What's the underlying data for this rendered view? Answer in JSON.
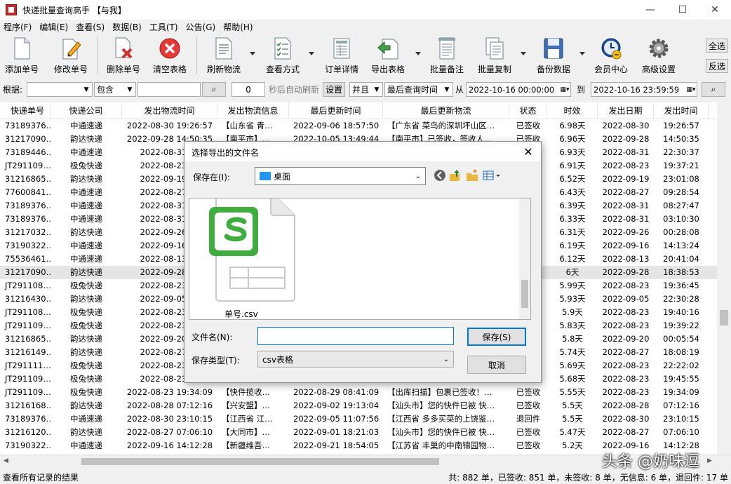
{
  "window": {
    "title": "快递批量查询高手 【与我】",
    "ctrl_minimize": "—",
    "ctrl_maximize": "☐",
    "ctrl_close": "✕"
  },
  "menu": [
    "程序(F)",
    "编辑(E)",
    "查看(S)",
    "数据(B)",
    "工具(T)",
    "公告(G)",
    "帮助(H)"
  ],
  "toolbar": {
    "add": "添加单号",
    "edit": "修改单号",
    "delete": "删除单号",
    "clear": "清空表格",
    "refresh": "刷新物流",
    "view_mode": "查看方式",
    "order_detail": "订单详情",
    "export": "导出表格",
    "batch_note": "批量备注",
    "batch_copy": "批量复制",
    "backup": "备份数据",
    "member": "会员中心",
    "advanced": "高级设置",
    "select_all": "全选",
    "invert": "反选"
  },
  "filter": {
    "label": "根据:",
    "field_value": "",
    "match_value": "包含",
    "keyword": "",
    "search_icon": "⌕",
    "interval_value": "0",
    "auto_refresh_text": "秒后自动刷新",
    "set_button": "设置",
    "logic_value": "并且",
    "time_field_value": "最后查询时间",
    "from_label": "从",
    "from_value": "2022-10-16 00:00:00",
    "to_label": "到",
    "to_value": "2022-10-16 23:59:59"
  },
  "table": {
    "columns": [
      "快递单号",
      "快递公司",
      "发出物流时间",
      "发出物流信息",
      "最后更新时间",
      "最后更新物流",
      "状态",
      "时效",
      "发出日期",
      "发出时间"
    ],
    "selected_row": 11,
    "rows": [
      [
        "73189376…",
        "中通速递",
        "2022-08-30 19:26:57",
        "【山东省 青…",
        "2022-09-06 18:57:50",
        "【广东省 菜鸟的深圳坪山区…",
        "已签收",
        "6.98天",
        "2022-08-30",
        "19:26:57"
      ],
      [
        "31217090…",
        "韵达快递",
        "2022-09-28 14:50:35",
        "【南平市】…",
        "2022-10-05 13:49:44",
        "【南平市】已签收，签收人…",
        "已签收",
        "6.96天",
        "2022-09-28",
        "14:50:35"
      ],
      [
        "73189446…",
        "中通速递",
        "2022-08-31 22",
        "",
        "",
        "",
        "已签收",
        "6.93天",
        "2022-08-31",
        "22:30:37"
      ],
      [
        "JT291109…",
        "极兔快递",
        "2022-08-23 19",
        "",
        "",
        "",
        "已签收",
        "6.91天",
        "2022-08-23",
        "19:37:21"
      ],
      [
        "31216865…",
        "韵达快递",
        "2022-09-19 23",
        "",
        "",
        "",
        "已签收",
        "6.52天",
        "2022-09-19",
        "23:01:08"
      ],
      [
        "77600841…",
        "中通速递",
        "2022-08-27 09",
        "",
        "",
        "",
        "已签收",
        "6.43天",
        "2022-08-27",
        "09:28:54"
      ],
      [
        "73189376…",
        "中通速递",
        "2022-08-31 08",
        "",
        "",
        "",
        "已签收",
        "6.39天",
        "2022-08-31",
        "08:27:47"
      ],
      [
        "73189376…",
        "中通速递",
        "2022-08-31 03",
        "",
        "",
        "",
        "已签收",
        "6.33天",
        "2022-08-31",
        "03:10:30"
      ],
      [
        "31217032…",
        "韵达快递",
        "2022-09-26 00",
        "",
        "",
        "",
        "已签收",
        "6.31天",
        "2022-09-26",
        "00:28:08"
      ],
      [
        "73190322…",
        "中通速递",
        "2022-09-16 14",
        "",
        "",
        "",
        "已签收",
        "6.19天",
        "2022-09-16",
        "14:13:24"
      ],
      [
        "75536461…",
        "中通速递",
        "2022-08-13 20",
        "",
        "",
        "",
        "已签收",
        "6.12天",
        "2022-08-13",
        "20:41:04"
      ],
      [
        "31217090…",
        "韵达快递",
        "2022-09-28 18",
        "",
        "",
        "",
        "已签收",
        "6天",
        "2022-09-28",
        "18:38:53"
      ],
      [
        "JT291108…",
        "极兔快递",
        "2022-08-23 19",
        "",
        "",
        "",
        "已签收",
        "5.99天",
        "2022-08-23",
        "19:36:45"
      ],
      [
        "31216430…",
        "韵达快递",
        "2022-09-05 22",
        "",
        "",
        "",
        "已签收",
        "5.93天",
        "2022-09-05",
        "22:30:28"
      ],
      [
        "JT291108…",
        "极兔快递",
        "2022-08-23 19",
        "",
        "",
        "",
        "已签收",
        "5.9天",
        "2022-08-23",
        "19:40:16"
      ],
      [
        "JT291109…",
        "极兔快递",
        "2022-08-23 19",
        "",
        "",
        "",
        "已签收",
        "5.83天",
        "2022-08-23",
        "19:39:22"
      ],
      [
        "31216865…",
        "韵达快递",
        "2022-09-20 00",
        "",
        "",
        "",
        "已签收",
        "5.8天",
        "2022-09-20",
        "00:05:54"
      ],
      [
        "31216149…",
        "韵达快递",
        "2022-08-27 18",
        "",
        "",
        "",
        "已签收",
        "5.74天",
        "2022-08-27",
        "18:08:19"
      ],
      [
        "JT291111…",
        "极兔快递",
        "2022-08-23 22",
        "",
        "",
        "",
        "已签收",
        "5.69天",
        "2022-08-23",
        "22:22:02"
      ],
      [
        "JT291109…",
        "极兔快递",
        "2022-08-23 19",
        "",
        "",
        "",
        "已签收",
        "5.68天",
        "2022-08-23",
        "19:45:55"
      ],
      [
        "JT291109…",
        "极兔快递",
        "2022-08-23 19:34:09",
        "【快件揽收…",
        "2022-08-29 08:41:09",
        "【出库扫描】包裹已签收！…",
        "已签收",
        "5.55天",
        "2022-08-23",
        "19:34:09"
      ],
      [
        "31216168…",
        "韵达快递",
        "2022-08-28 07:12:16",
        "【兴安盟】…",
        "2022-09-02 19:13:04",
        "【汕头市】您的快件已被 快…",
        "已签收",
        "5.5天",
        "2022-08-28",
        "07:12:16"
      ],
      [
        "73189376…",
        "中通速递",
        "2022-08-30 23:10:15",
        "【江西省 江…",
        "2022-09-05 11:07:56",
        "【江西省 多多买菜的上饶鉴…",
        "退回件",
        "5.5天",
        "2022-08-30",
        "23:10:15"
      ],
      [
        "31216120…",
        "韵达快递",
        "2022-08-27 07:06:10",
        "【大同市】…",
        "2022-09-01 18:21:03",
        "【汕头市】您的快件已被 快…",
        "已签收",
        "5.47天",
        "2022-08-27",
        "07:06:10"
      ],
      [
        "73190322…",
        "中通速递",
        "2022-09-16 14:12:28",
        "【新疆维吾…",
        "2022-09-21 18:54:05",
        "【江苏省 丰巢的中南锦园物…",
        "已签收",
        "5.2天",
        "2022-09-16",
        "14:12:28"
      ]
    ]
  },
  "status": {
    "left": "查看所有记录的结果",
    "right": "共: 882 单，已签收: 851 单，未签收: 8 单，无信息: 6 单，退回件: 17 单"
  },
  "watermark": "头条 @奶味逗",
  "dialog": {
    "title": "选择导出的文件名",
    "close": "✕",
    "save_in_label": "保存在(I):",
    "save_in_value": "桌面",
    "file_name": "单号.csv",
    "filename_label": "文件名(N):",
    "filename_value": "",
    "filetype_label": "保存类型(T):",
    "filetype_value": "csv表格",
    "save_button": "保存(S)",
    "cancel_button": "取消"
  },
  "colors": {
    "accent_blue": "#0078d7",
    "spreadsheet_green": "#3fae3f",
    "delete_red": "#d32f2f"
  }
}
